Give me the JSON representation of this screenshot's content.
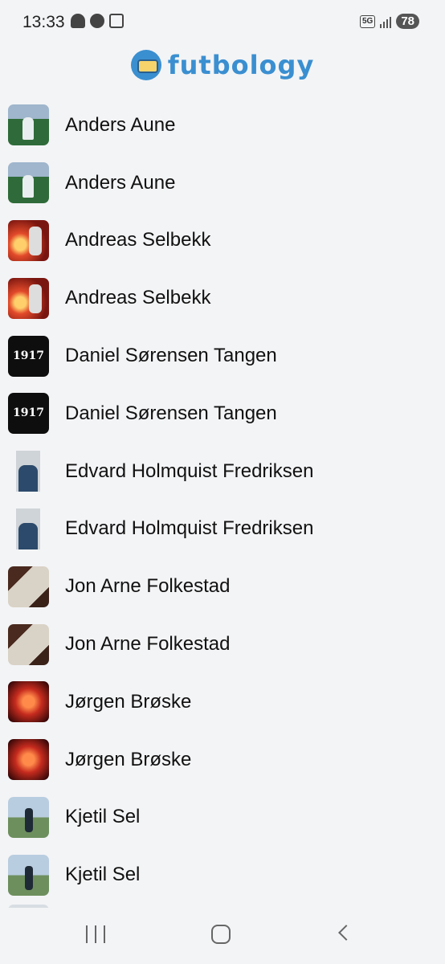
{
  "status_bar": {
    "time": "13:33",
    "network": "5G",
    "battery": "78"
  },
  "header": {
    "logo_text": "futbology"
  },
  "players": [
    {
      "name": "Anders Aune",
      "thumb": "stadium-photo"
    },
    {
      "name": "Anders Aune",
      "thumb": "stadium-photo"
    },
    {
      "name": "Andreas Selbekk",
      "thumb": "flare-photo"
    },
    {
      "name": "Andreas Selbekk",
      "thumb": "flare-photo"
    },
    {
      "name": "Daniel Sørensen Tangen",
      "thumb": "1917-badge",
      "thumb_text": "1917"
    },
    {
      "name": "Daniel Sørensen Tangen",
      "thumb": "1917-badge",
      "thumb_text": "1917"
    },
    {
      "name": "Edvard Holmquist Fredriksen",
      "thumb": "portrait-photo"
    },
    {
      "name": "Edvard Holmquist Fredriksen",
      "thumb": "portrait-photo"
    },
    {
      "name": "Jon Arne Folkestad",
      "thumb": "paper-photo"
    },
    {
      "name": "Jon Arne Folkestad",
      "thumb": "paper-photo"
    },
    {
      "name": "Jørgen Brøske",
      "thumb": "red-lights-photo"
    },
    {
      "name": "Jørgen Brøske",
      "thumb": "red-lights-photo"
    },
    {
      "name": "Kjetil Sel",
      "thumb": "field-photo"
    },
    {
      "name": "Kjetil Sel",
      "thumb": "field-photo"
    }
  ],
  "colors": {
    "brand": "#3a8fd0",
    "background": "#f3f4f6"
  }
}
